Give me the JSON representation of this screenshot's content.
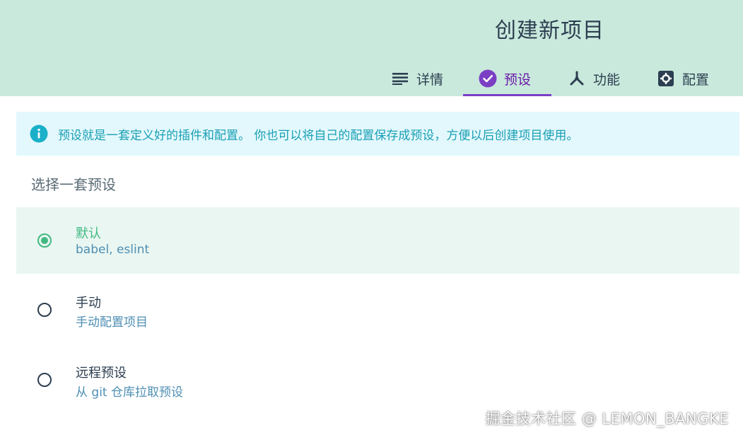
{
  "header": {
    "title": "创建新项目",
    "tabs": [
      {
        "label": "详情",
        "icon": "list-icon"
      },
      {
        "label": "预设",
        "icon": "check-circle-icon",
        "active": true
      },
      {
        "label": "功能",
        "icon": "branch-icon"
      },
      {
        "label": "配置",
        "icon": "gear-icon"
      }
    ]
  },
  "info": {
    "icon": "info-icon",
    "text": "预设就是一套定义好的插件和配置。 你也可以将自己的配置保存成预设，方便以后创建项目使用。"
  },
  "section_title": "选择一套预设",
  "options": [
    {
      "name": "默认",
      "desc": "babel, eslint",
      "selected": true
    },
    {
      "name": "手动",
      "desc": "手动配置项目",
      "selected": false
    },
    {
      "name": "远程预设",
      "desc": "从 git 仓库拉取预设",
      "selected": false
    }
  ],
  "watermark": "掘金技术社区 @ LEMON_BANGKE",
  "colors": {
    "header_bg": "#c9e9dc",
    "accent_purple": "#7b3fc4",
    "accent_green": "#42b983",
    "info_bg": "#e3f8fc",
    "info_text": "#1a9fb5"
  }
}
